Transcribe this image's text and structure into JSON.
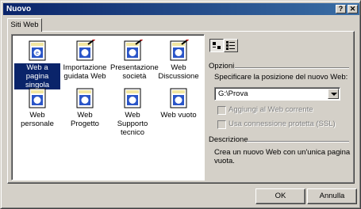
{
  "window": {
    "title": "Nuovo",
    "help_glyph": "?",
    "close_glyph": "✕"
  },
  "tab": {
    "label": "Siti Web"
  },
  "templates": [
    {
      "label": "Web a pagina singola",
      "icon": "web-page-icon",
      "selected": true
    },
    {
      "label": "Importazione guidata Web",
      "icon": "web-wizard-icon",
      "selected": false
    },
    {
      "label": "Presentazione società",
      "icon": "web-wizard-icon",
      "selected": false
    },
    {
      "label": "Web Discussione",
      "icon": "web-wizard-icon",
      "selected": false
    },
    {
      "label": "Web personale",
      "icon": "web-page-icon",
      "selected": false
    },
    {
      "label": "Web Progetto",
      "icon": "web-page-icon",
      "selected": false
    },
    {
      "label": "Web Supporto tecnico",
      "icon": "web-page-icon",
      "selected": false
    },
    {
      "label": "Web vuoto",
      "icon": "web-page-icon",
      "selected": false
    }
  ],
  "options": {
    "heading": "Opzioni",
    "location_label": "Specificare la posizione del nuovo Web:",
    "location_value": "G:\\Prova",
    "add_to_current": "Aggiungi al Web corrente",
    "secure_connection": "Usa connessione protetta (SSL)"
  },
  "description": {
    "heading": "Descrizione",
    "text_line1": "Crea un nuovo Web con un'unica pagina",
    "text_line2": "vuota."
  },
  "buttons": {
    "ok": "OK",
    "cancel": "Annulla"
  },
  "colors": {
    "titlebar": "#0a246a",
    "selection": "#0a246a",
    "face": "#d4d0c8"
  }
}
